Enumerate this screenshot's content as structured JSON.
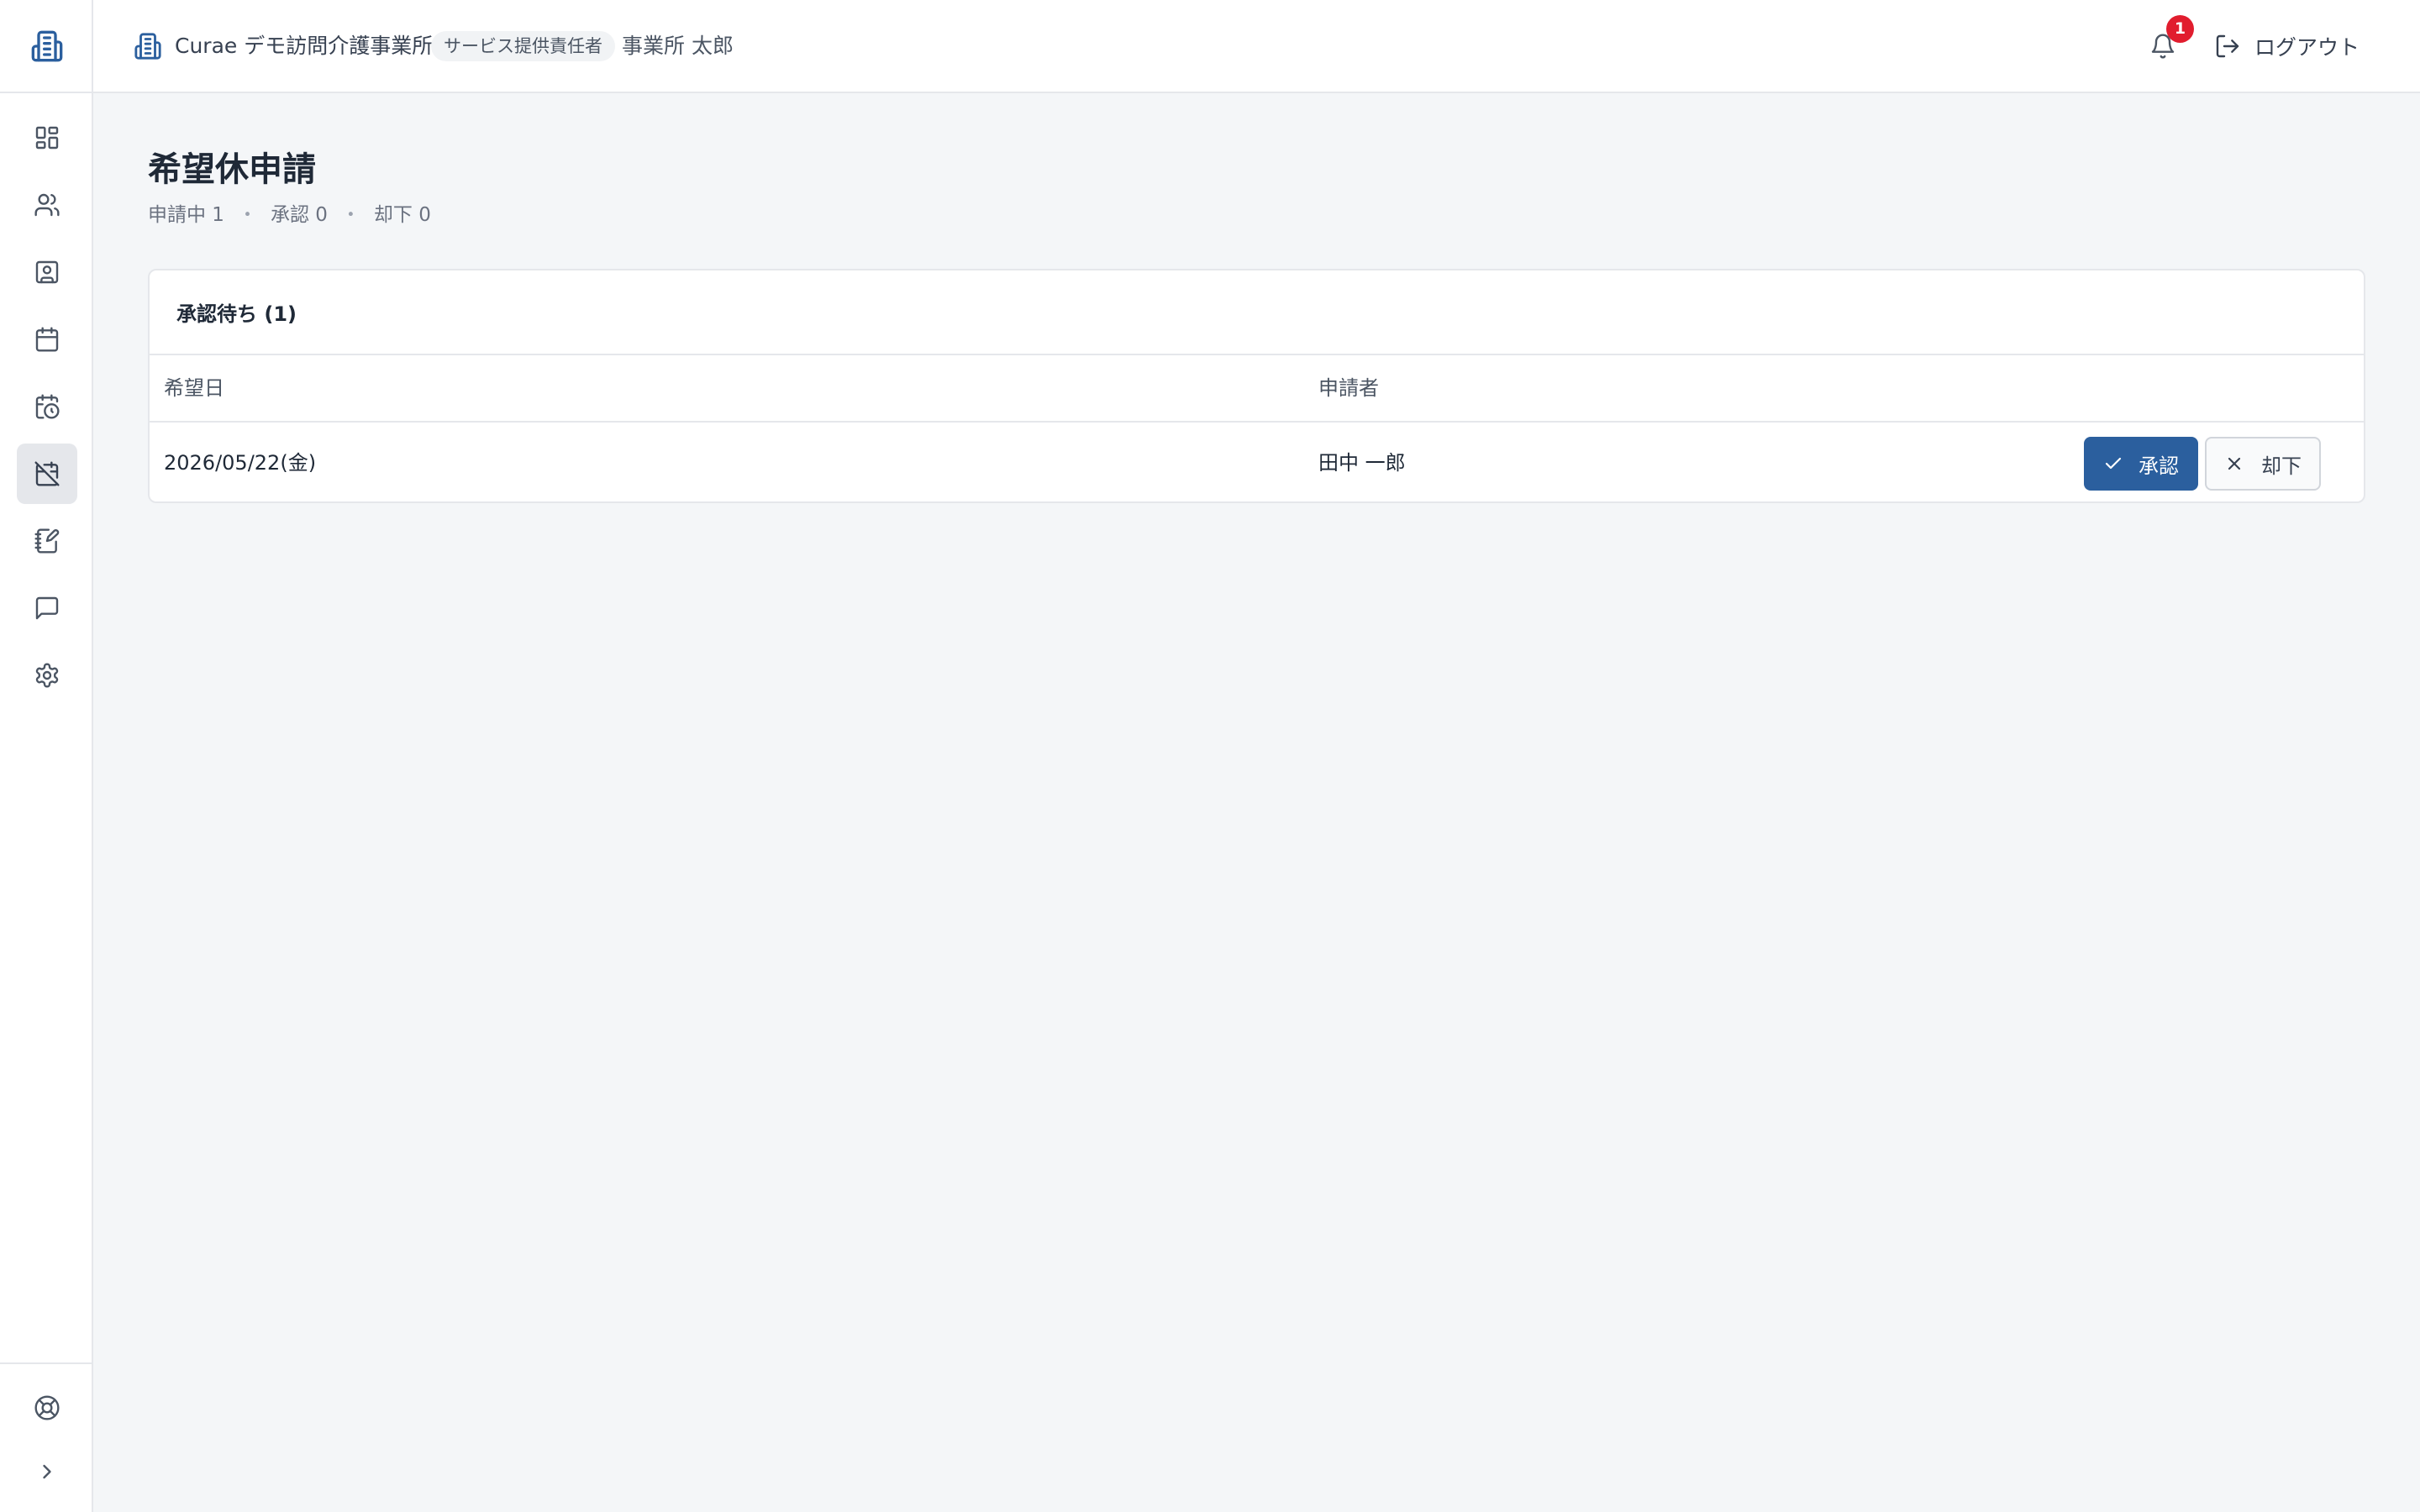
{
  "header": {
    "org_name": "Curae デモ訪問介護事業所",
    "role_badge": "サービス提供責任者",
    "user_name": "事業所 太郎",
    "notification_count": "1",
    "logout_label": "ログアウト"
  },
  "sidebar": {
    "items": [
      {
        "icon": "dashboard-icon"
      },
      {
        "icon": "users-icon"
      },
      {
        "icon": "contact-card-icon"
      },
      {
        "icon": "calendar-icon"
      },
      {
        "icon": "calendar-clock-icon"
      },
      {
        "icon": "calendar-off-icon",
        "active": true
      },
      {
        "icon": "notebook-pen-icon"
      },
      {
        "icon": "message-icon"
      },
      {
        "icon": "gear-icon"
      }
    ],
    "bottom": [
      {
        "icon": "lifebuoy-icon"
      },
      {
        "icon": "chevron-right-icon"
      }
    ]
  },
  "main": {
    "title": "希望休申請",
    "summary": {
      "pending": "申請中 1",
      "approved": "承認 0",
      "rejected": "却下 0"
    },
    "card": {
      "title": "承認待ち (1)",
      "columns": [
        "希望日",
        "申請者"
      ],
      "rows": [
        {
          "date": "2026/05/22(金)",
          "applicant": "田中 一郎",
          "approve_label": "承認",
          "reject_label": "却下"
        }
      ]
    }
  },
  "colors": {
    "primary": "#2b5f9e",
    "badge_red": "#e11d2e",
    "background": "#f4f6f8"
  }
}
